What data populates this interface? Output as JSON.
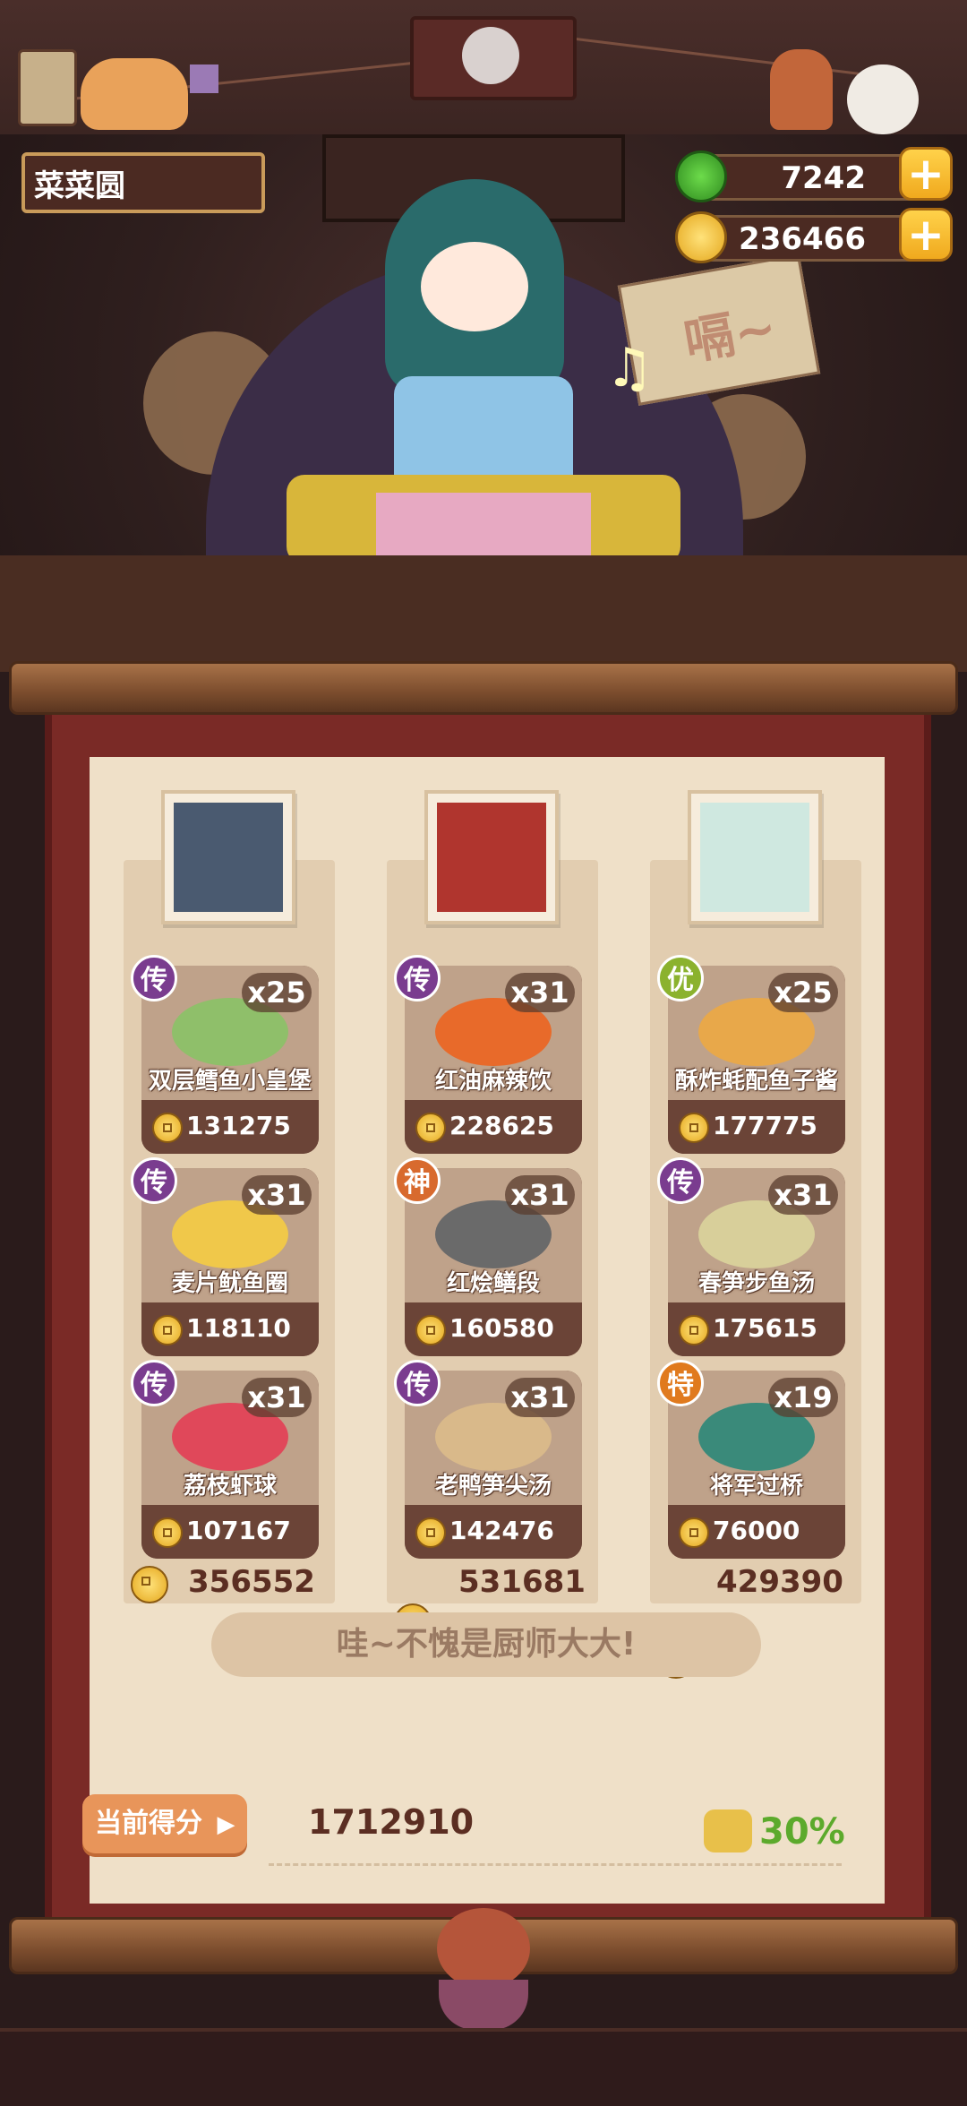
{
  "restaurant_name": "菜菜圆",
  "resources": {
    "jade": "7242",
    "coins": "236466"
  },
  "scene": {
    "speech_bubble": "嗝~"
  },
  "columns": [
    {
      "total": "356552",
      "dishes": [
        {
          "rank": "传",
          "count": "x25",
          "name": "双层鳕鱼小皇堡",
          "price": "131275"
        },
        {
          "rank": "传",
          "count": "x31",
          "name": "麦片鱿鱼圈",
          "price": "118110"
        },
        {
          "rank": "传",
          "count": "x31",
          "name": "荔枝虾球",
          "price": "107167"
        }
      ]
    },
    {
      "total": "531681",
      "dishes": [
        {
          "rank": "传",
          "count": "x31",
          "name": "红油麻辣饮",
          "price": "228625"
        },
        {
          "rank": "神",
          "count": "x31",
          "name": "红烩鳝段",
          "price": "160580"
        },
        {
          "rank": "传",
          "count": "x31",
          "name": "老鸭笋尖汤",
          "price": "142476"
        }
      ]
    },
    {
      "total": "429390",
      "dishes": [
        {
          "rank": "优",
          "count": "x25",
          "name": "酥炸蚝配鱼子酱",
          "price": "177775"
        },
        {
          "rank": "传",
          "count": "x31",
          "name": "春笋步鱼汤",
          "price": "175615"
        },
        {
          "rank": "特",
          "count": "x19",
          "name": "将军过桥",
          "price": "76000"
        }
      ]
    }
  ],
  "praise_text": "哇~不愧是厨师大大!",
  "score": {
    "label": "当前得分",
    "value": "1712910",
    "bonus": "30%"
  },
  "colors": {
    "rank_legend": "#7a3c8f",
    "rank_god": "#d86a2e",
    "rank_good": "#8bb22e",
    "rank_special": "#e07a1e"
  }
}
